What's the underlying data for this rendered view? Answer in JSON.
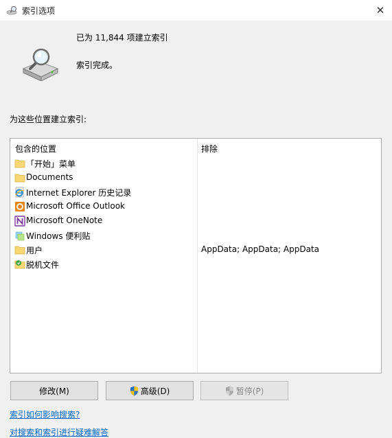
{
  "window": {
    "title": "索引选项",
    "close_glyph": "✕"
  },
  "status": {
    "count_text": "已为 11,844 项建立索引",
    "state_text": "索引完成。"
  },
  "locations": {
    "section_label": "为这些位置建立索引:",
    "header_included": "包含的位置",
    "header_excluded": "排除",
    "rows": [
      {
        "icon": "folder-icon",
        "name": "「开始」菜单",
        "exclude": ""
      },
      {
        "icon": "folder-icon",
        "name": "Documents",
        "exclude": ""
      },
      {
        "icon": "internet-explorer-icon",
        "name": "Internet Explorer 历史记录",
        "exclude": ""
      },
      {
        "icon": "outlook-icon",
        "name": "Microsoft Office Outlook",
        "exclude": ""
      },
      {
        "icon": "onenote-icon",
        "name": "Microsoft OneNote",
        "exclude": ""
      },
      {
        "icon": "sticky-notes-icon",
        "name": "Windows 便利贴",
        "exclude": ""
      },
      {
        "icon": "folder-icon",
        "name": "用户",
        "exclude": "AppData; AppData; AppData"
      },
      {
        "icon": "offline-files-icon",
        "name": "脱机文件",
        "exclude": ""
      }
    ]
  },
  "buttons": {
    "modify": "修改(M)",
    "advanced": "高级(D)",
    "pause": "暂停(P)"
  },
  "links": {
    "how_indexing": "索引如何影响搜索?",
    "troubleshoot": "对搜索和索引进行疑难解答"
  },
  "colors": {
    "link": "#0066cc",
    "folder": "#f8d775",
    "outlook": "#e8830f",
    "onenote": "#7b3a9e"
  }
}
